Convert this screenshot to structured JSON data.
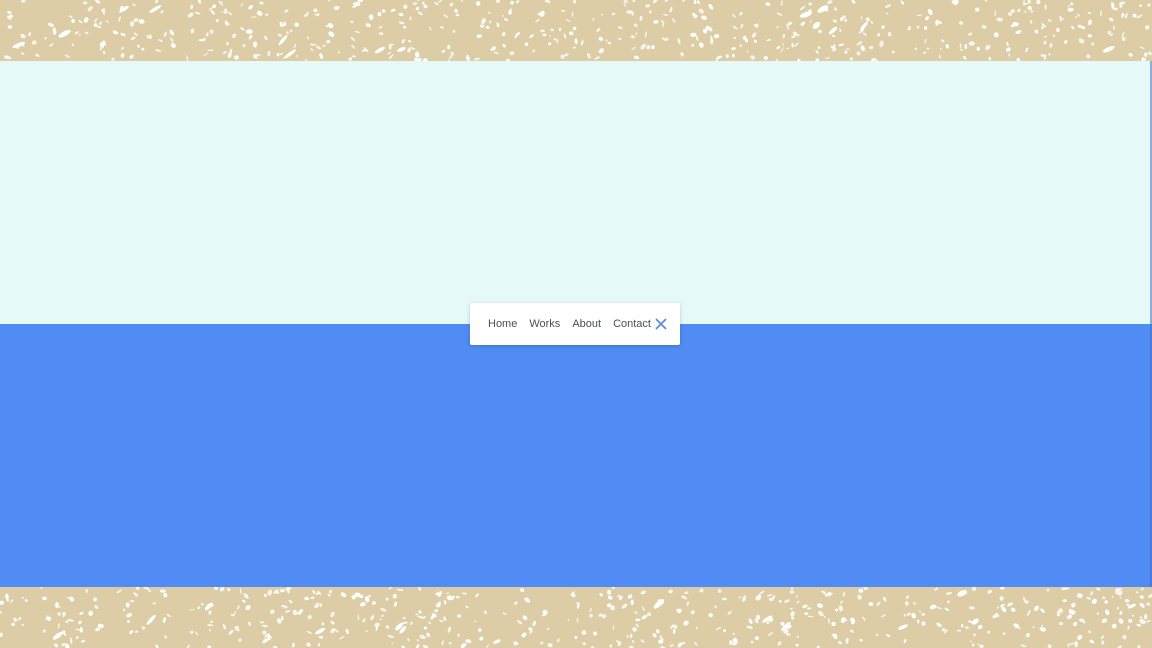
{
  "nav": {
    "items": [
      {
        "label": "Home"
      },
      {
        "label": "Works"
      },
      {
        "label": "About"
      },
      {
        "label": "Contact"
      }
    ],
    "close_icon": "close-icon"
  },
  "colors": {
    "sand": "#dccda7",
    "speckle": "#ffffff",
    "upper_panel": "#e4f9f8",
    "lower_panel": "#508cf3",
    "close_icon": "#5b8fe6",
    "link_text": "#4a4f57"
  }
}
